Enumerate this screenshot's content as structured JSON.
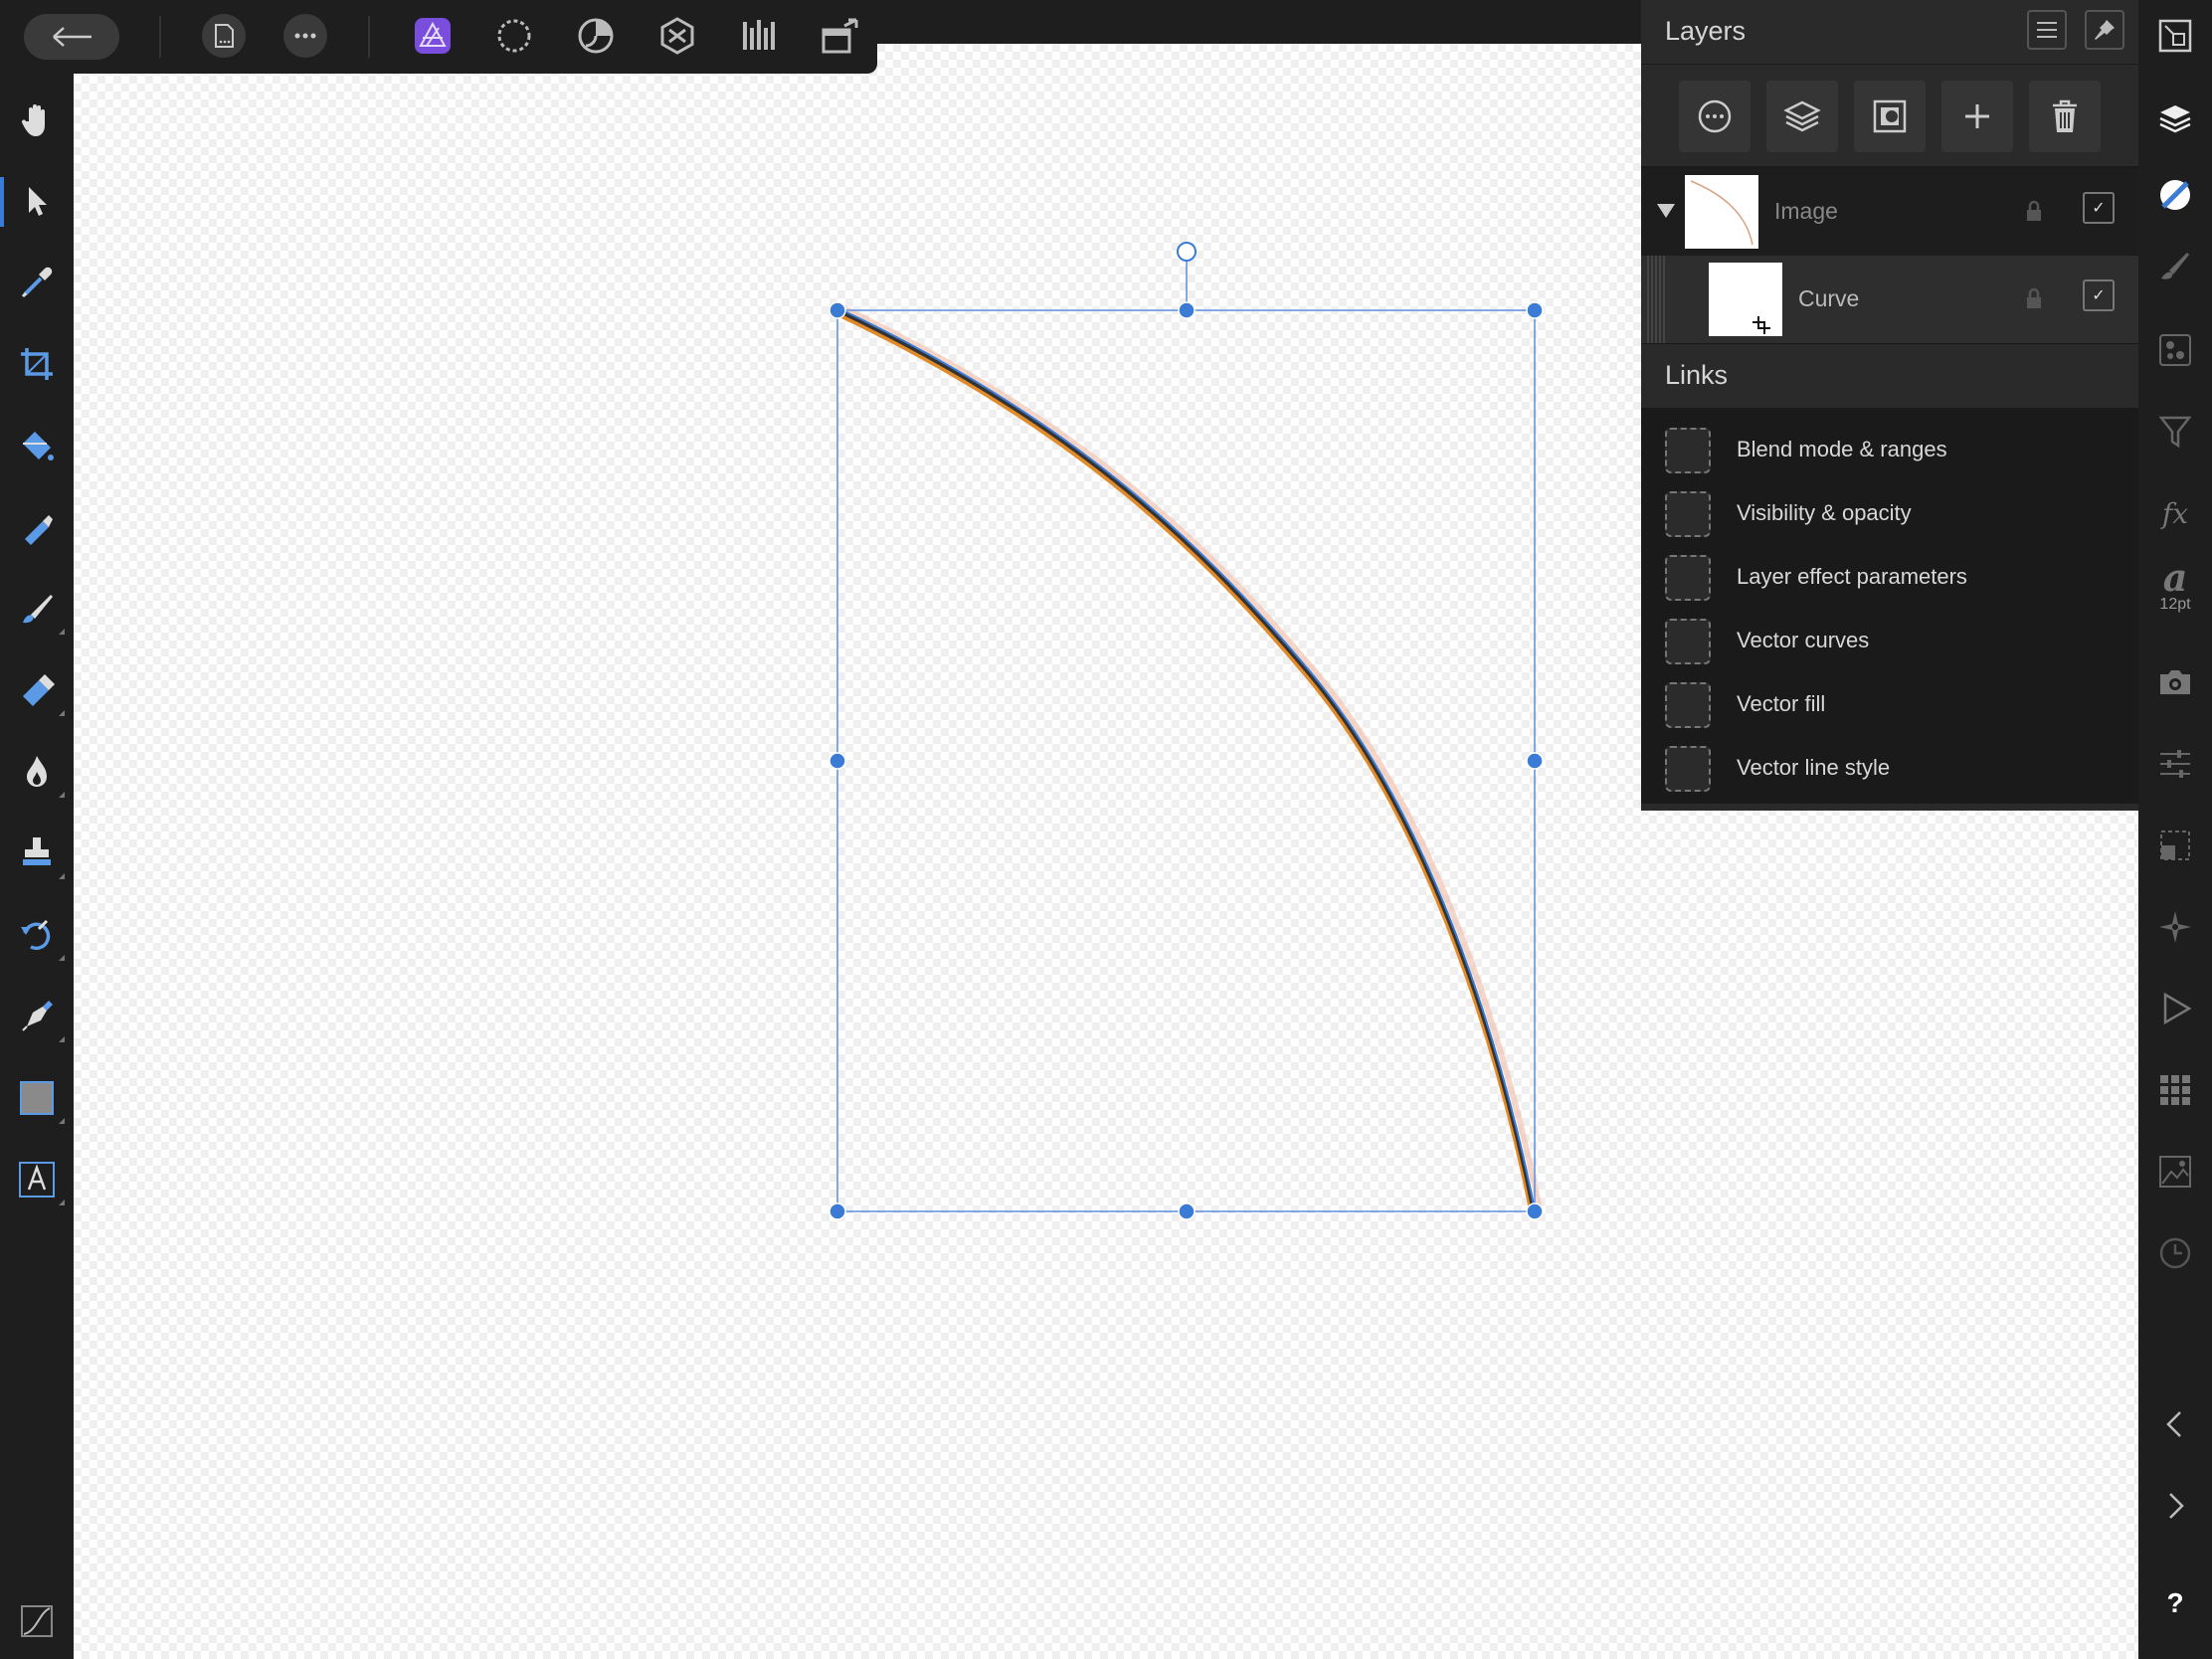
{
  "layers_panel": {
    "title": "Layers",
    "layers": [
      {
        "name": "Image",
        "visible": true,
        "expanded": true
      },
      {
        "name": "Curve",
        "visible": true,
        "selected": true
      }
    ]
  },
  "links": {
    "title": "Links",
    "items": [
      "Blend mode & ranges",
      "Visibility & opacity",
      "Layer effect parameters",
      "Vector curves",
      "Vector fill",
      "Vector line style"
    ]
  },
  "right_column": {
    "font_size_label": "12pt",
    "help_label": "?"
  },
  "colors": {
    "accent": "#3a7bd5",
    "persona_active": "#7b4ddd",
    "selection": "#3a7bd5",
    "curve_stroke": "#333333",
    "curve_orange": "#e08a2a"
  }
}
